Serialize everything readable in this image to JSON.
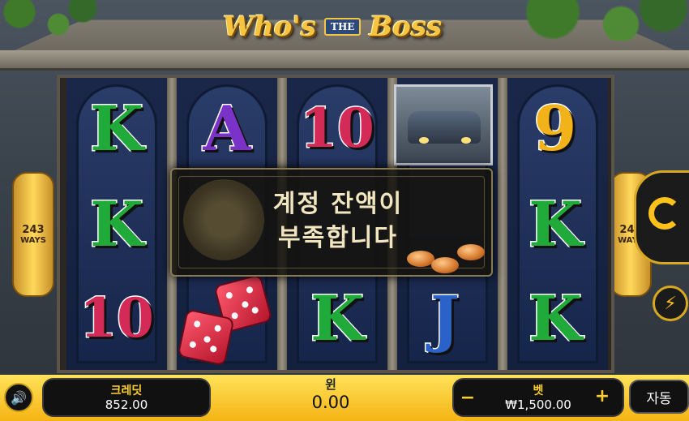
{
  "game": {
    "logo_left": "Who's",
    "logo_middle": "THE",
    "logo_right": "Boss"
  },
  "reels": [
    [
      "K",
      "K",
      "10"
    ],
    [
      "A",
      "",
      ""
    ],
    [
      "10",
      "",
      "K"
    ],
    [
      "",
      "",
      "J"
    ],
    [
      "9",
      "K",
      "K"
    ]
  ],
  "ways": {
    "left_count": "243",
    "left_label": "WAYS",
    "right_count": "243",
    "right_label": "WAYS"
  },
  "popup": {
    "line1": "계정 잔액이",
    "line2": "부족합니다"
  },
  "bottom_bar": {
    "credit_label": "크레딧",
    "credit_value": "852.00",
    "win_label": "윈",
    "win_value": "0.00",
    "bet_label": "벳",
    "bet_value": "₩1,500.00",
    "minus": "−",
    "plus": "+",
    "auto_label": "자동"
  },
  "icons": {
    "volume": "volume-icon",
    "spin": "spin-icon",
    "turbo": "lightning-icon"
  },
  "colors": {
    "accent_gold": "#f5b414",
    "panel_dark": "#111111"
  }
}
